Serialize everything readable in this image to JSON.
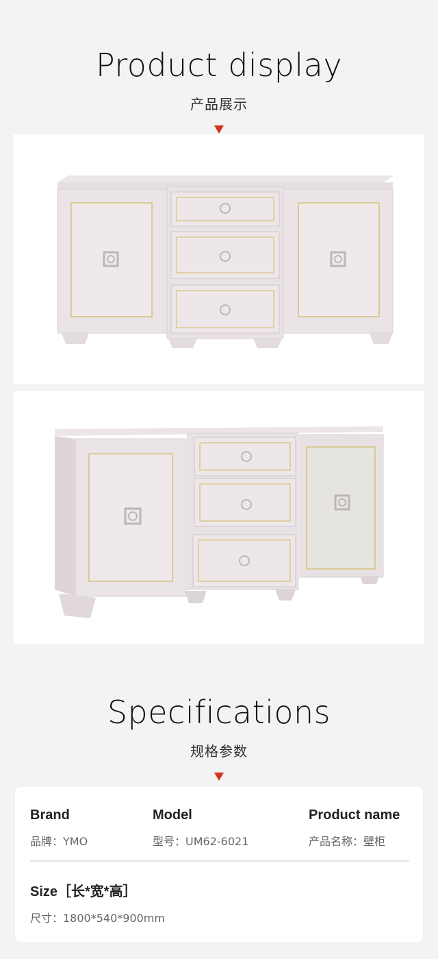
{
  "product_display": {
    "title_en": "Product display",
    "title_cn": "产品展示"
  },
  "specifications": {
    "title_en": "Specifications",
    "title_cn": "规格参数",
    "brand": {
      "label": "Brand",
      "value": "品牌：YMO"
    },
    "model": {
      "label": "Model",
      "value": "型号：UM62-6021"
    },
    "product_name": {
      "label": "Product name",
      "value": "产品名称：壁柜"
    },
    "size": {
      "label": "Size［长*宽*高］",
      "value": "尺寸：1800*540*900mm"
    }
  },
  "colors": {
    "accent": "#d2321f",
    "cabinet": "#e9e2e4",
    "trim": "#d6c27a"
  }
}
